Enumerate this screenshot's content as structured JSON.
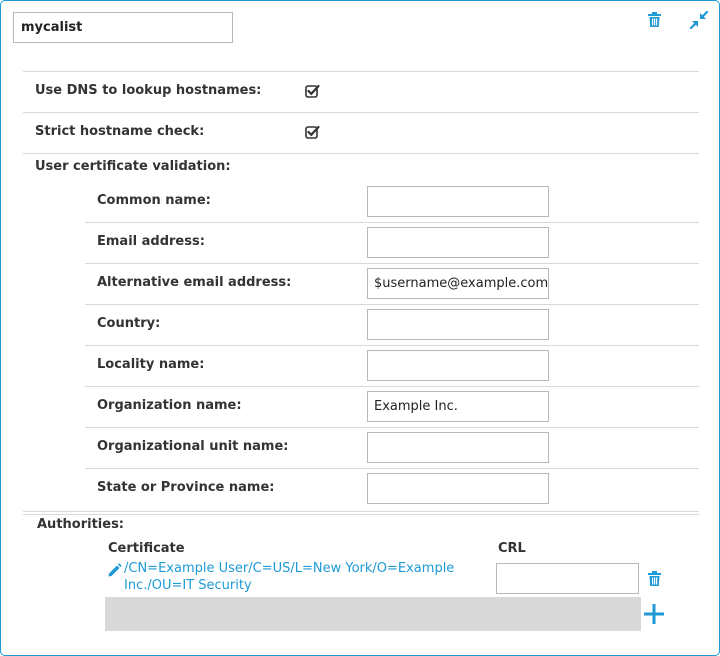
{
  "header": {
    "name_value": "mycalist",
    "delete_icon": "trash-icon",
    "collapse_icon": "collapse-arrows-icon"
  },
  "options": {
    "dns_label": "Use DNS to lookup hostnames:",
    "dns_checked": true,
    "strict_label": "Strict hostname check:",
    "strict_checked": true,
    "validation_label": "User certificate validation:"
  },
  "validation_fields": [
    {
      "label": "Common name:",
      "value": ""
    },
    {
      "label": "Email address:",
      "value": ""
    },
    {
      "label": "Alternative email address:",
      "value": "$username@example.com"
    },
    {
      "label": "Country:",
      "value": ""
    },
    {
      "label": "Locality name:",
      "value": ""
    },
    {
      "label": "Organization name:",
      "value": "Example Inc."
    },
    {
      "label": "Organizational unit name:",
      "value": ""
    },
    {
      "label": "State or Province name:",
      "value": ""
    }
  ],
  "authorities": {
    "label": "Authorities:",
    "col_certificate": "Certificate",
    "col_crl": "CRL",
    "rows": [
      {
        "certificate_line1": "/CN=Example User/C=US/L=New York/O=Example",
        "certificate_line2": "Inc./OU=IT Security",
        "crl": ""
      }
    ],
    "edit_icon": "pencil-icon",
    "delete_icon": "trash-icon",
    "add_icon": "plus-icon"
  },
  "colors": {
    "accent": "#1e9ad6",
    "border": "#b8b8b8",
    "divider": "#d9d9d9"
  }
}
